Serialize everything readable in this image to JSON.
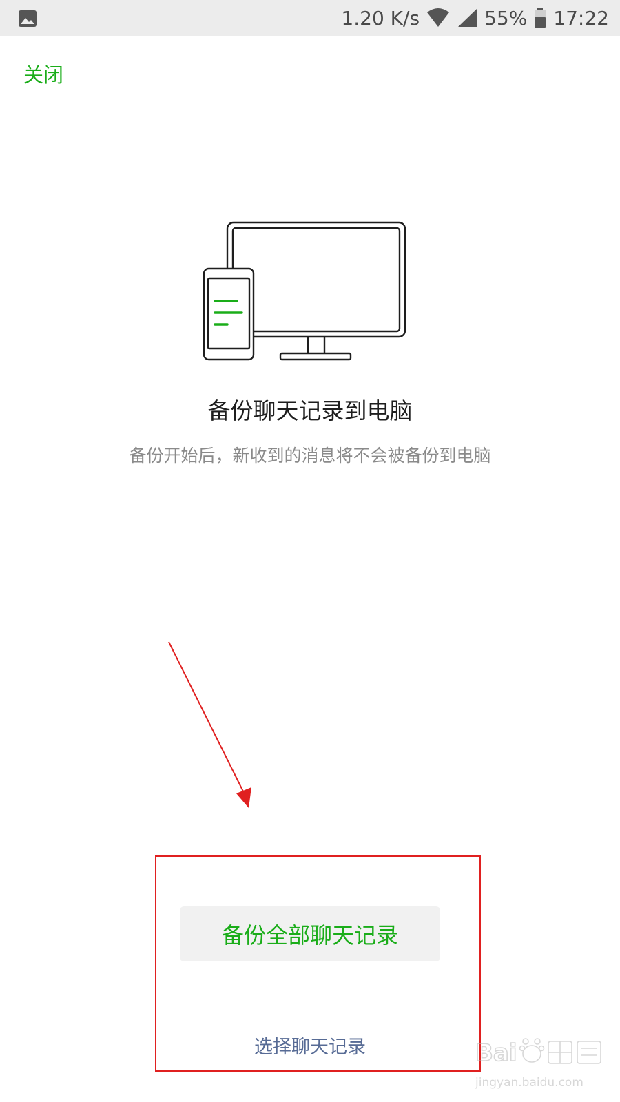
{
  "status_bar": {
    "network_speed": "1.20 K/s",
    "battery_percent": "55%",
    "time": "17:22",
    "icons": [
      "gallery-icon",
      "wifi-icon",
      "signal-icon",
      "battery-icon"
    ]
  },
  "header": {
    "close_label": "关闭"
  },
  "main": {
    "illustration": "monitor-phone-icon",
    "title": "备份聊天记录到电脑",
    "subtitle": "备份开始后，新收到的消息将不会被备份到电脑"
  },
  "actions": {
    "backup_all_label": "备份全部聊天记录",
    "select_records_label": "选择聊天记录"
  },
  "annotation": {
    "highlight_color": "#e02020"
  },
  "watermark": {
    "url_text": "jingyan.baidu.com"
  },
  "colors": {
    "accent_green": "#1aad19",
    "link_blue": "#576b95",
    "status_bar_bg": "#ececec"
  }
}
